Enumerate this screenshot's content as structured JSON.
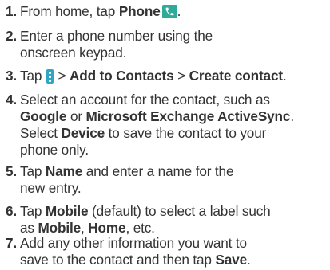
{
  "steps": [
    {
      "num": "1.",
      "a": "From home, tap ",
      "b": "Phone",
      "icon": "phone-icon",
      "c": "."
    },
    {
      "num": "2.",
      "line1": "Enter a phone number using the",
      "line2": "onscreen keypad."
    },
    {
      "num": "3.",
      "a": "Tap ",
      "icon": "menu-icon",
      "b": " > ",
      "c": "Add to Contacts",
      "d": " > ",
      "e": "Create contact",
      "f": "."
    },
    {
      "num": "4.",
      "a": "Select an account for the contact, such as",
      "b": "Google",
      "c": " or ",
      "d": "Microsoft Exchange ActiveSync",
      "e": ".",
      "f": "Select ",
      "g": "Device",
      "h": " to save the contact to your",
      "i": "phone only."
    },
    {
      "num": "5.",
      "a": "Tap ",
      "b": "Name",
      "c": " and enter a name for the",
      "d": "new entry."
    },
    {
      "num": "6.",
      "a": "Tap ",
      "b": "Mobile",
      "c": " (default) to select a label such",
      "d": "as ",
      "e": "Mobile",
      "f": ", ",
      "g": "Home",
      "h": ", etc."
    },
    {
      "num": "7.",
      "a": "Add any other information you want to",
      "b": "save to the contact and then tap ",
      "c": "Save",
      "d": "."
    }
  ],
  "colors": {
    "text": "#333333",
    "phone_icon_bg": "#2eaa9b",
    "menu_icon_bg": "#2fa7c4"
  }
}
